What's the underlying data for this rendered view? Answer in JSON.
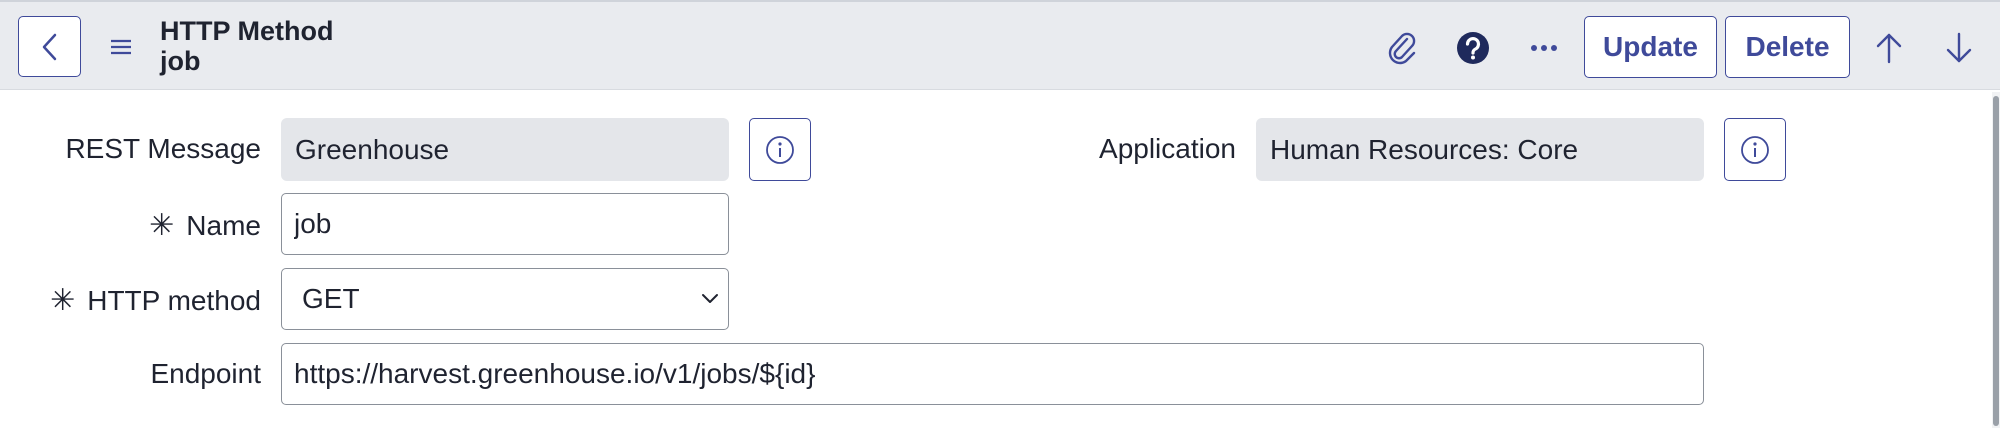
{
  "header": {
    "title": "HTTP Method",
    "subtitle": "job",
    "update_label": "Update",
    "delete_label": "Delete",
    "icons": [
      "back-icon",
      "hamburger-menu-icon",
      "paperclip-icon",
      "help-icon",
      "more-icon",
      "arrow-up-icon",
      "arrow-down-icon"
    ]
  },
  "form": {
    "rest_message": {
      "label": "REST Message",
      "value": "Greenhouse"
    },
    "application": {
      "label": "Application",
      "value": "Human Resources: Core"
    },
    "name": {
      "label": "Name",
      "value": "job",
      "required_mark": "✳"
    },
    "http_method": {
      "label": "HTTP method",
      "value": "GET",
      "required_mark": "✳"
    },
    "endpoint": {
      "label": "Endpoint",
      "value": "https://harvest.greenhouse.io/v1/jobs/${id}"
    }
  },
  "colors": {
    "accent": "#3f4a9a",
    "header_bg": "#e9ebef",
    "readonly_bg": "#e4e6ea",
    "help_icon": "#1f2a5c"
  }
}
